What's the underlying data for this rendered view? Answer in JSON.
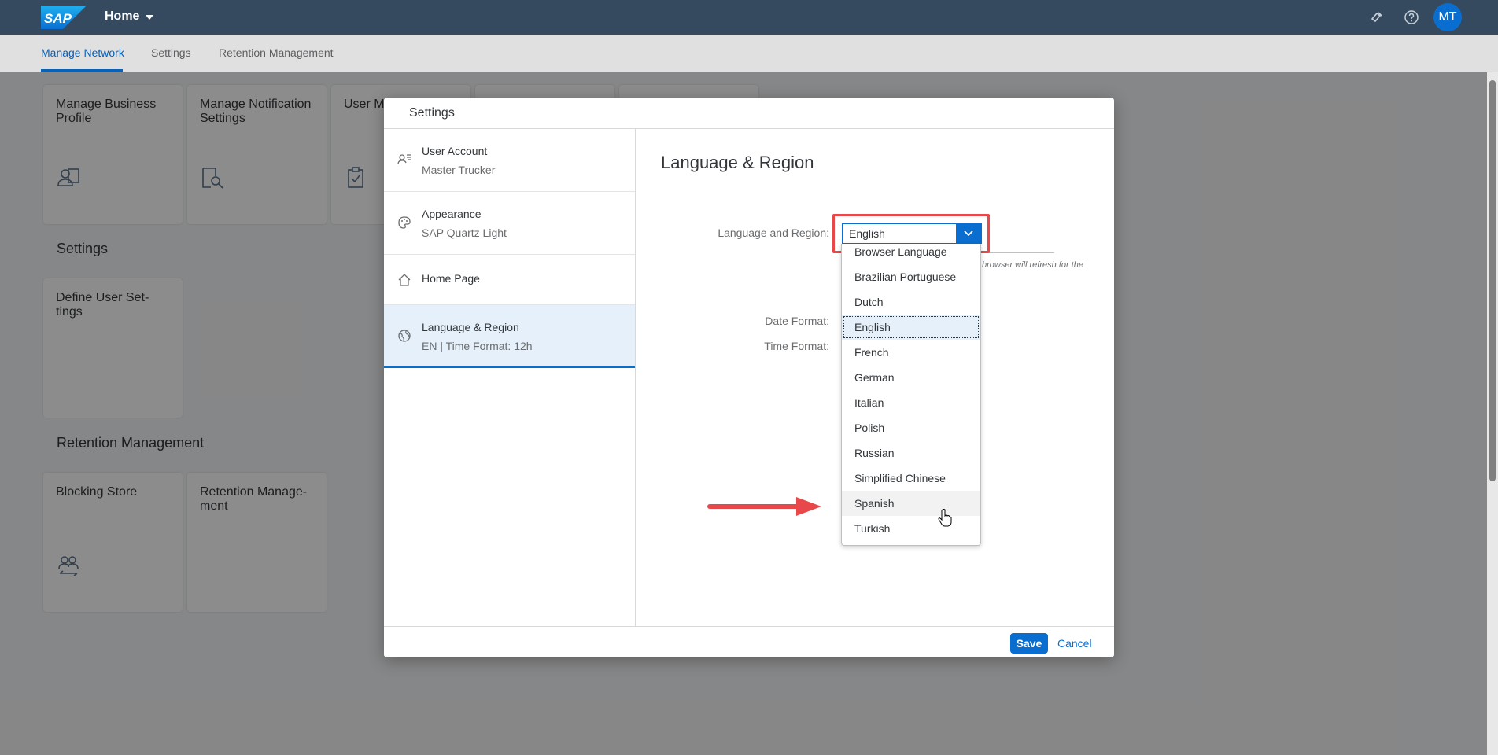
{
  "shell": {
    "logo": "SAP",
    "home_label": "Home",
    "avatar_initials": "MT"
  },
  "tabs": [
    {
      "label": "Manage Network"
    },
    {
      "label": "Settings"
    },
    {
      "label": "Retention Management"
    }
  ],
  "tiles": {
    "manage_business_profile": "Manage Business Profile",
    "manage_notification_settings": "Manage Notification Settings",
    "user_management_partial": "User M",
    "define_user_settings": "Define User Set-tings",
    "blocking_store": "Blocking Store",
    "retention_management": "Retention Manage-ment"
  },
  "sections": {
    "settings": "Settings",
    "retention": "Retention Management"
  },
  "dialog": {
    "title": "Settings",
    "nav": [
      {
        "title": "User Account",
        "subtitle": "Master Trucker"
      },
      {
        "title": "Appearance",
        "subtitle": "SAP Quartz Light"
      },
      {
        "title": "Home Page"
      },
      {
        "title": "Language & Region",
        "subtitle": "EN | Time Format: 12h"
      }
    ],
    "content_title": "Language & Region",
    "labels": {
      "language": "Language and Region:",
      "date_format": "Date Format:",
      "time_format": "Time Format:"
    },
    "selected_language": "English",
    "note": "browser will refresh for the",
    "save": "Save",
    "cancel": "Cancel"
  },
  "dropdown": {
    "options": [
      "Browser Language",
      "Brazilian Portuguese",
      "Dutch",
      "English",
      "French",
      "German",
      "Italian",
      "Polish",
      "Russian",
      "Simplified Chinese",
      "Spanish",
      "Turkish"
    ]
  },
  "colors": {
    "shell": "#354a5f",
    "brand": "#0a6ed1",
    "highlight": "#e8484a"
  }
}
